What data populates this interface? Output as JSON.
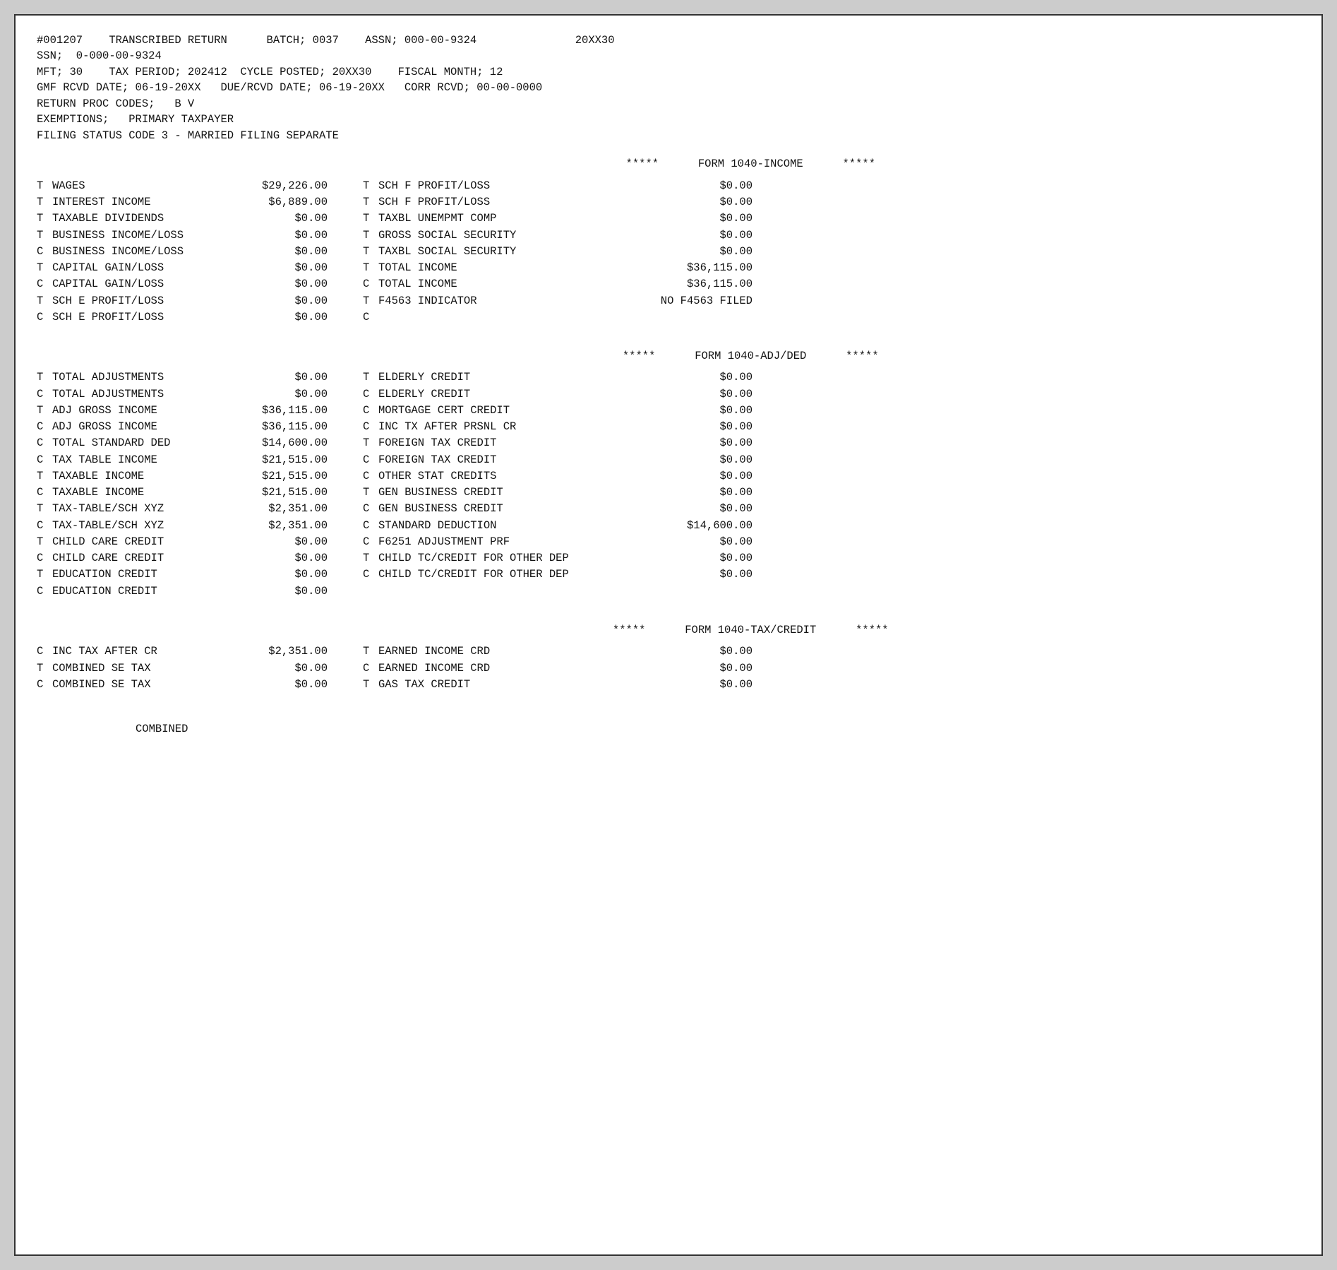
{
  "header": {
    "line1": "#001207    TRANSCRIBED RETURN      BATCH; 0037    ASSN; 000-00-9324               20XX30",
    "line2": "SSN;  0-000-00-9324",
    "line3": "MFT; 30    TAX PERIOD; 202412  CYCLE POSTED; 20XX30    FISCAL MONTH; 12",
    "line4": "GMF RCVD DATE; 06-19-20XX   DUE/RCVD DATE; 06-19-20XX   CORR RCVD; 00-00-0000",
    "line5": "RETURN PROC CODES;   B V",
    "line6": "EXEMPTIONS;   PRIMARY TAXPAYER",
    "line7": "FILING STATUS CODE 3 - MARRIED FILING SEPARATE"
  },
  "income_section": {
    "title": "                         *****      FORM 1040-INCOME      *****",
    "rows": [
      {
        "p1": "T",
        "l1": "WAGES",
        "v1": "$29,226.00",
        "p2": "T",
        "l2": "SCH F PROFIT/LOSS",
        "v2": "$0.00"
      },
      {
        "p1": "T",
        "l1": "INTEREST INCOME",
        "v1": "$6,889.00",
        "p2": "T",
        "l2": "SCH F PROFIT/LOSS",
        "v2": "$0.00"
      },
      {
        "p1": "T",
        "l1": "TAXABLE DIVIDENDS",
        "v1": "$0.00",
        "p2": "T",
        "l2": "TAXBL UNEMPMT COMP",
        "v2": "$0.00"
      },
      {
        "p1": "T",
        "l1": "BUSINESS INCOME/LOSS",
        "v1": "$0.00",
        "p2": "T",
        "l2": "GROSS SOCIAL SECURITY",
        "v2": "$0.00"
      },
      {
        "p1": "C",
        "l1": "BUSINESS INCOME/LOSS",
        "v1": "$0.00",
        "p2": "T",
        "l2": "TAXBL SOCIAL SECURITY",
        "v2": "$0.00"
      },
      {
        "p1": "T",
        "l1": "CAPITAL GAIN/LOSS",
        "v1": "$0.00",
        "p2": "T",
        "l2": "TOTAL INCOME",
        "v2": "$36,115.00"
      },
      {
        "p1": "C",
        "l1": "CAPITAL GAIN/LOSS",
        "v1": "$0.00",
        "p2": "C",
        "l2": "TOTAL INCOME",
        "v2": "$36,115.00"
      },
      {
        "p1": "T",
        "l1": "SCH E PROFIT/LOSS",
        "v1": "$0.00",
        "p2": "T",
        "l2": "F4563 INDICATOR",
        "v2": "NO F4563 FILED"
      },
      {
        "p1": "C",
        "l1": "SCH E PROFIT/LOSS",
        "v1": "$0.00",
        "p2": "C",
        "l2": "",
        "v2": ""
      }
    ]
  },
  "adjded_section": {
    "title": "                         *****      FORM 1040-ADJ/DED      *****",
    "rows": [
      {
        "p1": "T",
        "l1": "TOTAL ADJUSTMENTS",
        "v1": "$0.00",
        "p2": "T",
        "l2": "ELDERLY CREDIT",
        "v2": "$0.00"
      },
      {
        "p1": "C",
        "l1": "TOTAL ADJUSTMENTS",
        "v1": "$0.00",
        "p2": "C",
        "l2": "ELDERLY CREDIT",
        "v2": "$0.00"
      },
      {
        "p1": "T",
        "l1": "ADJ GROSS INCOME",
        "v1": "$36,115.00",
        "p2": "C",
        "l2": "MORTGAGE CERT CREDIT",
        "v2": "$0.00"
      },
      {
        "p1": "C",
        "l1": "ADJ GROSS INCOME",
        "v1": "$36,115.00",
        "p2": "C",
        "l2": "INC TX AFTER PRSNL CR",
        "v2": "$0.00"
      },
      {
        "p1": "C",
        "l1": "TOTAL STANDARD DED",
        "v1": "$14,600.00",
        "p2": "T",
        "l2": "FOREIGN TAX CREDIT",
        "v2": "$0.00"
      },
      {
        "p1": "C",
        "l1": "TAX TABLE INCOME",
        "v1": "$21,515.00",
        "p2": "C",
        "l2": "FOREIGN TAX CREDIT",
        "v2": "$0.00"
      },
      {
        "p1": "T",
        "l1": "TAXABLE INCOME",
        "v1": "$21,515.00",
        "p2": "C",
        "l2": "OTHER STAT CREDITS",
        "v2": "$0.00"
      },
      {
        "p1": "C",
        "l1": "TAXABLE INCOME",
        "v1": "$21,515.00",
        "p2": "T",
        "l2": "GEN BUSINESS CREDIT",
        "v2": "$0.00"
      },
      {
        "p1": "T",
        "l1": "TAX-TABLE/SCH XYZ",
        "v1": "$2,351.00",
        "p2": "C",
        "l2": "GEN BUSINESS CREDIT",
        "v2": "$0.00"
      },
      {
        "p1": "C",
        "l1": "TAX-TABLE/SCH XYZ",
        "v1": "$2,351.00",
        "p2": "C",
        "l2": "STANDARD DEDUCTION",
        "v2": "$14,600.00"
      },
      {
        "p1": "T",
        "l1": "CHILD CARE CREDIT",
        "v1": "$0.00",
        "p2": "C",
        "l2": "F6251 ADJUSTMENT PRF",
        "v2": "$0.00"
      },
      {
        "p1": "C",
        "l1": "CHILD CARE CREDIT",
        "v1": "$0.00",
        "p2": "T",
        "l2": "CHILD TC/CREDIT FOR OTHER DEP",
        "v2": "$0.00"
      },
      {
        "p1": "T",
        "l1": "EDUCATION CREDIT",
        "v1": "$0.00",
        "p2": "C",
        "l2": "CHILD TC/CREDIT FOR OTHER DEP",
        "v2": "$0.00"
      },
      {
        "p1": "C",
        "l1": "EDUCATION CREDIT",
        "v1": "$0.00",
        "p2": "",
        "l2": "",
        "v2": ""
      }
    ]
  },
  "taxcredit_section": {
    "title": "                         *****      FORM 1040-TAX/CREDIT      *****",
    "rows": [
      {
        "p1": "C",
        "l1": "INC TAX AFTER CR",
        "v1": "$2,351.00",
        "p2": "T",
        "l2": "EARNED INCOME CRD",
        "v2": "$0.00"
      },
      {
        "p1": "T",
        "l1": "COMBINED SE TAX",
        "v1": "$0.00",
        "p2": "C",
        "l2": "EARNED INCOME CRD",
        "v2": "$0.00"
      },
      {
        "p1": "C",
        "l1": "COMBINED SE TAX",
        "v1": "$0.00",
        "p2": "T",
        "l2": "GAS TAX CREDIT",
        "v2": "$0.00"
      }
    ]
  },
  "footer": {
    "combined": "COMBINED"
  }
}
